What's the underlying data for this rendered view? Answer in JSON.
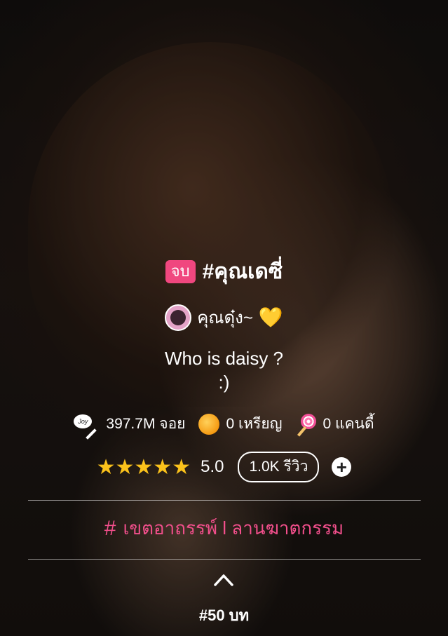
{
  "story": {
    "status_badge": "จบ",
    "title": "#คุณเดซี่",
    "author_name": "คุณดุ๋ง~",
    "author_emoji": "💛",
    "description_line1": "Who is daisy ?",
    "description_line2": ":)"
  },
  "stats": {
    "joy_icon_text": "Joy",
    "views": "397.7M จอย",
    "coins": "0 เหรียญ",
    "candies": "0 แคนดี้"
  },
  "rating": {
    "stars": "★★★★★",
    "score": "5.0",
    "reviews_label": "1.0K รีวิว",
    "add_icon": "+"
  },
  "tags": {
    "hash_icon": "#",
    "label": "เขตอาถรรพ์ l ลานฆาตกรรม"
  },
  "chapters": {
    "label": "#50 บท"
  },
  "colors": {
    "accent_pink": "#f0477f",
    "star_yellow": "#fbc21b"
  },
  "icons": {
    "avatar": "author-avatar",
    "joy": "joy-pen-icon",
    "coin": "coin-icon",
    "candy": "lollipop-icon",
    "chevron": "chevron-up-icon"
  }
}
